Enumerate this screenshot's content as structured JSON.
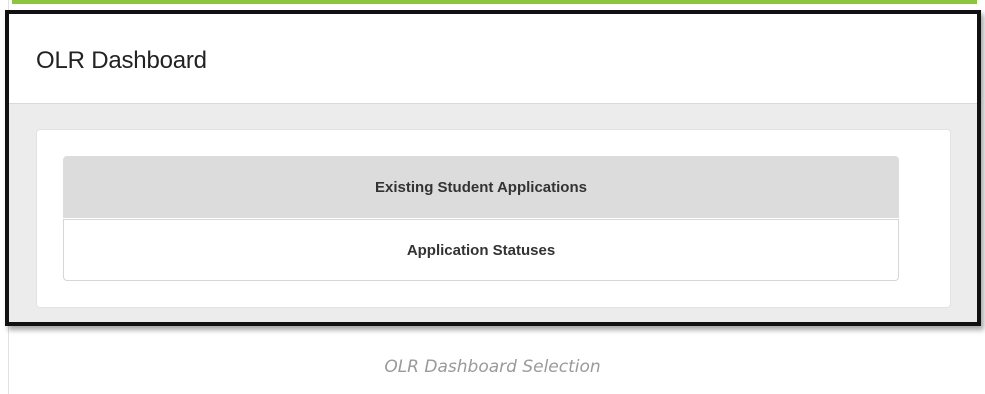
{
  "header": {
    "title": "OLR Dashboard"
  },
  "menu": {
    "items": [
      {
        "label": "Existing Student Applications",
        "selected": true
      },
      {
        "label": "Application Statuses",
        "selected": false
      }
    ]
  },
  "caption": "OLR Dashboard Selection",
  "colors": {
    "accent_bar": "#8cc63f",
    "selected_item_bg": "#dcdcdc",
    "frame_border": "#111111"
  }
}
